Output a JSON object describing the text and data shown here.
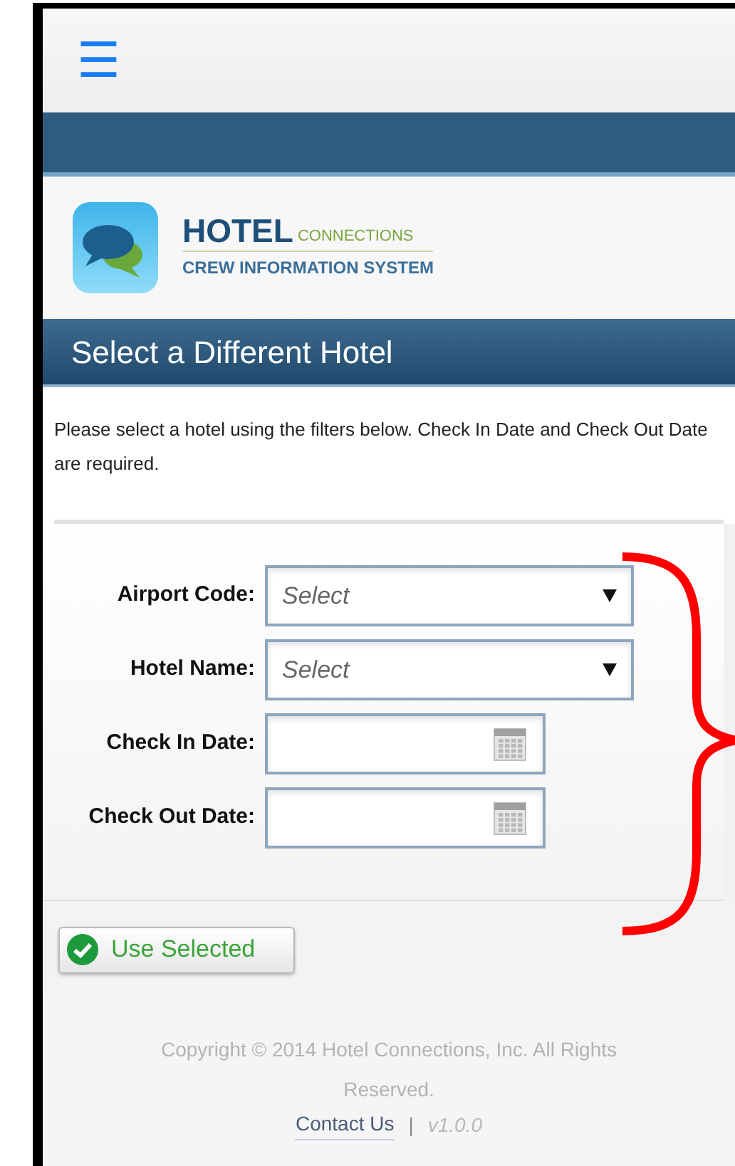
{
  "header": {
    "menu_icon": "☰"
  },
  "logo": {
    "title": "HOTEL",
    "subtitle": "CONNECTIONS",
    "tagline": "CREW INFORMATION SYSTEM"
  },
  "page_title": "Select a Different Hotel",
  "instructions": "Please select a hotel using the filters below. Check In Date and Check Out Date are required.",
  "form": {
    "fields": [
      {
        "kind": "select",
        "label": "Airport Code:",
        "placeholder": "Select"
      },
      {
        "kind": "select",
        "label": "Hotel Name:",
        "placeholder": "Select"
      },
      {
        "kind": "date",
        "label": "Check In Date:"
      },
      {
        "kind": "date",
        "label": "Check Out Date:"
      }
    ]
  },
  "submit_button": "Use Selected",
  "footer": {
    "copyright": "Copyright © 2014 Hotel Connections, Inc. All Rights Reserved.",
    "contact_link": "Contact Us",
    "separator": "|",
    "version": "v1.0.0"
  }
}
